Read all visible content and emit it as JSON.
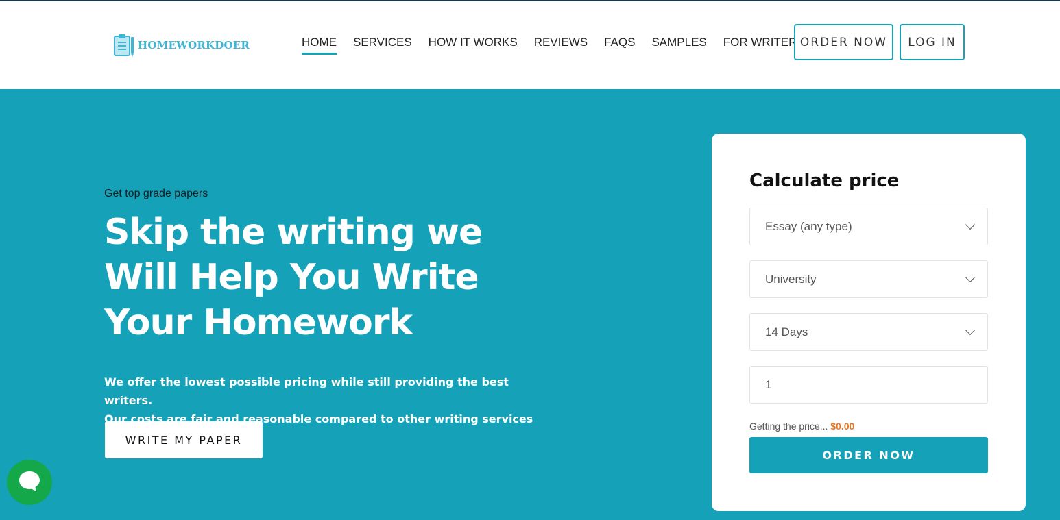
{
  "brand": {
    "name": "HOMEWORKDOER",
    "color": "#3fb6d6"
  },
  "nav": {
    "items": [
      {
        "label": "HOME",
        "active": true
      },
      {
        "label": "SERVICES",
        "active": false
      },
      {
        "label": "HOW IT WORKS",
        "active": false
      },
      {
        "label": "REVIEWS",
        "active": false
      },
      {
        "label": "FAQS",
        "active": false
      },
      {
        "label": "SAMPLES",
        "active": false
      },
      {
        "label": "FOR WRITERS",
        "active": false
      }
    ]
  },
  "header_buttons": {
    "order": "ORDER NOW",
    "login": "LOG IN"
  },
  "hero": {
    "eyebrow": "Get top grade papers",
    "headline_1": "Skip the writing we",
    "headline_2": "Will Help You Write",
    "headline_3": "Your Homework",
    "sub_1": "We offer the lowest possible pricing while still providing the best writers.",
    "sub_2": "Our costs are fair and reasonable compared to other writing services",
    "cta": "WRITE MY PAPER"
  },
  "calculator": {
    "title": "Calculate price",
    "paper_type": "Essay (any type)",
    "level": "University",
    "deadline": "14 Days",
    "pages": "1",
    "price_label": "Getting the price...",
    "price_value": "$0.00",
    "order_button": "ORDER NOW"
  },
  "icons": {
    "logo": "clipboard-icon",
    "chat": "chat-bubble-icon",
    "select": "chevron-down-icon"
  },
  "colors": {
    "accent": "#15a1b7",
    "price": "#e87722",
    "chat": "#14a84a"
  }
}
